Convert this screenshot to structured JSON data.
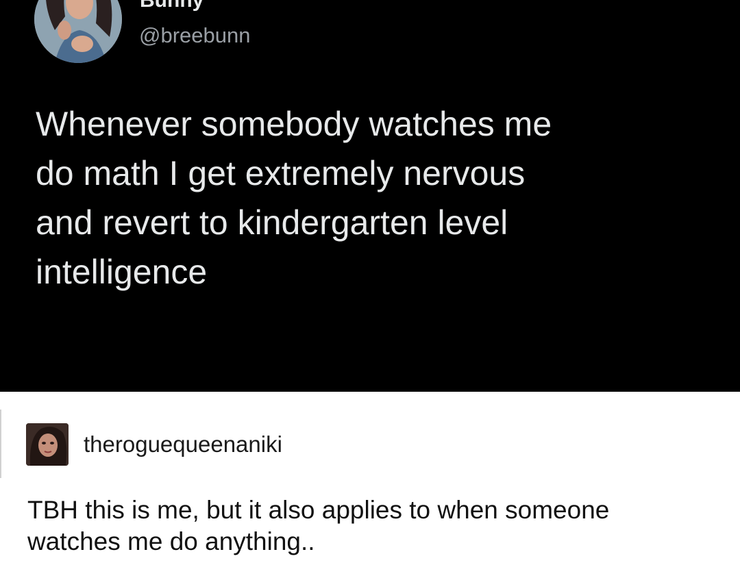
{
  "tweet": {
    "display_name": "Bunny",
    "handle": "@breebunn",
    "text": "Whenever somebody watches me\ndo math I get extremely nervous\nand revert to kindergarten level\nintelligence",
    "avatar_icon": "profile-photo-avatar",
    "background_color": "#000000",
    "text_color": "#e7e9ea",
    "handle_color": "#9a9fa5"
  },
  "reply": {
    "username": "theroguequeenaniki",
    "text": "TBH this is me, but it also applies to when someone\nwatches me do anything..",
    "avatar_icon": "profile-photo-avatar",
    "background_color": "#ffffff"
  }
}
